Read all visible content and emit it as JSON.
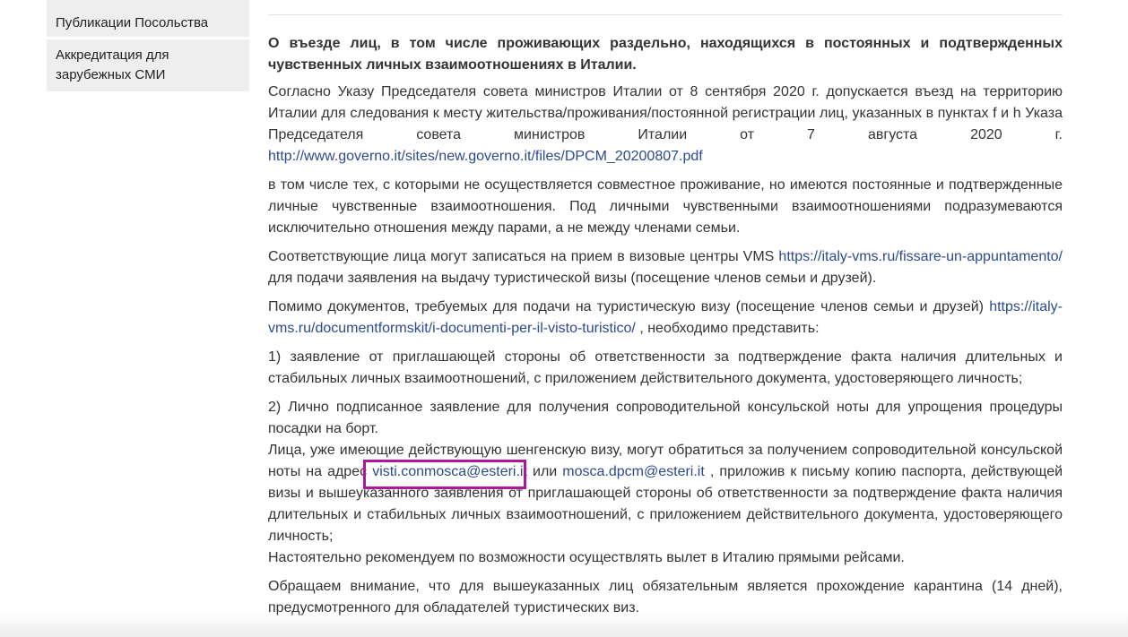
{
  "sidebar": {
    "items": [
      {
        "label": "Публикации Посольства"
      },
      {
        "label": "Аккредитация для зарубежных СМИ"
      }
    ]
  },
  "article": {
    "heading": "О въезде лиц, в том числе проживающих раздельно, находящихся в постоянных и подтвержденных чувственных личных взаимоотношениях в Италии.",
    "p1_text": "Согласно Указу Председателя совета министров Италии от 8 сентября 2020 г. допускается въезд на территорию Италии для следования к месту жительства/проживания/постоянной регистрации лиц, указанных в пунктах f и h Указа Председателя совета министров Италии от 7 августа 2020 г.",
    "p1_link": "http://www.governo.it/sites/new.governo.it/files/DPCM_20200807.pdf",
    "p2": "в том числе тех, с которыми не осуществляется совместное проживание, но имеются постоянные и подтвержденные личные чувственные взаимоотношения. Под личными чувственными взаимоотношениями подразумеваются исключительно отношения между парами, а не между членами семьи.",
    "p3_before": "Соответствующие лица могут записаться на прием в визовые центры VMS",
    "p3_link": "https://italy-vms.ru/fissare-un-appuntamento/",
    "p3_after": "для подачи заявления на выдачу туристической визы (посещение членов семьи и друзей).",
    "p4_before": "Помимо документов, требуемых для подачи на туристическую визу (посещение членов семьи и друзей)",
    "p4_link": "https://italy-vms.ru/documentformskit/i-documenti-per-il-visto-turistico/",
    "p4_after": ", необходимо представить:",
    "p5": "1) заявление от приглашающей стороны об ответственности за подтверждение факта наличия длительных и стабильных личных взаимоотношений, с приложением действительного документа, удостоверяющего личность;",
    "p6_line1": "2) Лично подписанное заявление для получения сопроводительной консульской ноты для упрощения процедуры посадки на борт.",
    "p6_before": "Лица, уже имеющие действующую шенгенскую визу, могут обратиться за получением сопроводительной консульской ноты на адрес",
    "email1": "visti.conmosca@esteri.it",
    "p6_or": "или",
    "email2": "mosca.dpcm@esteri.it",
    "p6_after": ", приложив к письму копию паспорта, действующей визы и вышеуказанного заявления от приглашающей стороны об ответственности за подтверждение факта наличия длительных и стабильных личных взаимоотношений, с приложением действительного документа, удостоверяющего личность;",
    "p6_last": "Настоятельно рекомендуем по возможности осуществлять вылет в Италию прямыми рейсами.",
    "p7": "Обращаем внимание, что для вышеуказанных лиц обязательным является прохождение карантина (14 дней), предусмотренного для обладателей туристических виз."
  },
  "colors": {
    "link": "#2b4a8f",
    "highlight": "#b0169a",
    "sidebar_bg": "#eeeeee"
  }
}
